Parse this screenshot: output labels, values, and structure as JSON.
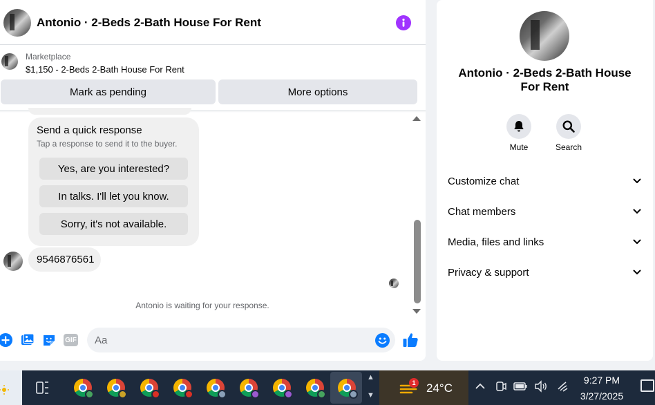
{
  "header": {
    "title": "Antonio · 2-Beds 2-Bath House For Rent",
    "info_icon": "info-icon"
  },
  "listing": {
    "source": "Marketplace",
    "title": "$1,150 - 2-Beds 2-Bath House For Rent"
  },
  "actions": {
    "pending_label": "Mark as pending",
    "more_label": "More options"
  },
  "quick_response": {
    "title": "Send a quick response",
    "subtitle": "Tap a response to send it to the buyer.",
    "options": [
      "Yes, are you interested?",
      "In talks. I'll let you know.",
      "Sorry, it's not available."
    ]
  },
  "messages": [
    {
      "text": "9546876561"
    }
  ],
  "status": {
    "waiting": "Antonio is waiting for your response."
  },
  "composer": {
    "placeholder": "Aa",
    "gif_label": "GIF"
  },
  "details": {
    "title": "Antonio · 2-Beds 2-Bath House For Rent",
    "mute_label": "Mute",
    "search_label": "Search",
    "sections": [
      "Customize chat",
      "Chat members",
      "Media, files and links",
      "Privacy & support"
    ]
  },
  "taskbar": {
    "weather_badge": "1",
    "temperature": "24°C",
    "time": "9:27 PM",
    "date": "3/27/2025"
  },
  "colors": {
    "accent_blue": "#0a7cff",
    "info_purple": "#a033ff",
    "button_gray": "#e4e6eb",
    "bubble_gray": "#f0f0f0",
    "taskbar": "#1d2a3c"
  }
}
